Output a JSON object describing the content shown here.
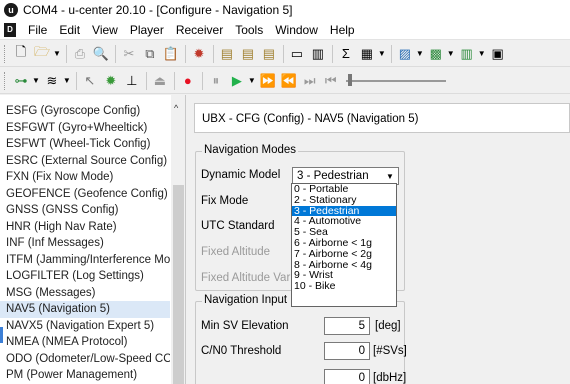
{
  "window": {
    "title": "COM4 - u-center 20.10 - [Configure - Navigation 5]",
    "app_icon": "u-center-icon",
    "doc_icon": "document-icon"
  },
  "menu": [
    "File",
    "Edit",
    "View",
    "Player",
    "Receiver",
    "Tools",
    "Window",
    "Help"
  ],
  "left_panel": {
    "items": [
      "ESFG (Gyroscope Config)",
      "ESFGWT (Gyro+Wheeltick)",
      "ESFWT (Wheel-Tick Config)",
      "ESRC (External Source Config)",
      "FXN (Fix Now Mode)",
      "GEOFENCE (Geofence Config)",
      "GNSS (GNSS Config)",
      "HNR (High Nav Rate)",
      "INF (Inf Messages)",
      "ITFM (Jamming/Interference Mor",
      "LOGFILTER (Log Settings)",
      "MSG (Messages)",
      "NAV5 (Navigation 5)",
      "NAVX5 (Navigation Expert 5)",
      "NMEA (NMEA Protocol)",
      "ODO (Odometer/Low-Speed COC",
      "PM (Power Management)"
    ],
    "selected_index": 12
  },
  "config": {
    "header": "UBX - CFG (Config) - NAV5 (Navigation 5)",
    "nav_modes": {
      "title": "Navigation Modes",
      "dynamic_model_label": "Dynamic Model",
      "dynamic_model_value": "3 - Pedestrian",
      "fix_mode_label": "Fix Mode",
      "utc_standard_label": "UTC Standard",
      "fixed_altitude_label": "Fixed Altitude",
      "fixed_altitude_var_label": "Fixed Altitude Var"
    },
    "dropdown_options": [
      "0 - Portable",
      "2 - Stationary",
      "3 - Pedestrian",
      "4 - Automotive",
      "5 - Sea",
      "6 - Airborne < 1g",
      "7 - Airborne < 2g",
      "8 - Airborne < 4g",
      "9 - Wrist",
      "10 - Bike"
    ],
    "dropdown_highlight_index": 2,
    "nav_input": {
      "title": "Navigation Input F",
      "min_sv_label": "Min SV Elevation",
      "min_sv_value": "5",
      "min_sv_unit": "[deg]",
      "cno_label": "C/N0 Threshold",
      "cno_value": "0",
      "cno_unit": "[#SVs]",
      "third_value": "0",
      "third_unit": "[dbHz]"
    }
  },
  "colors": {
    "selection_blue": "#0078d7",
    "tree_selected": "#dbe8f7",
    "play_green": "#22b14c",
    "record_red": "#e81123"
  }
}
